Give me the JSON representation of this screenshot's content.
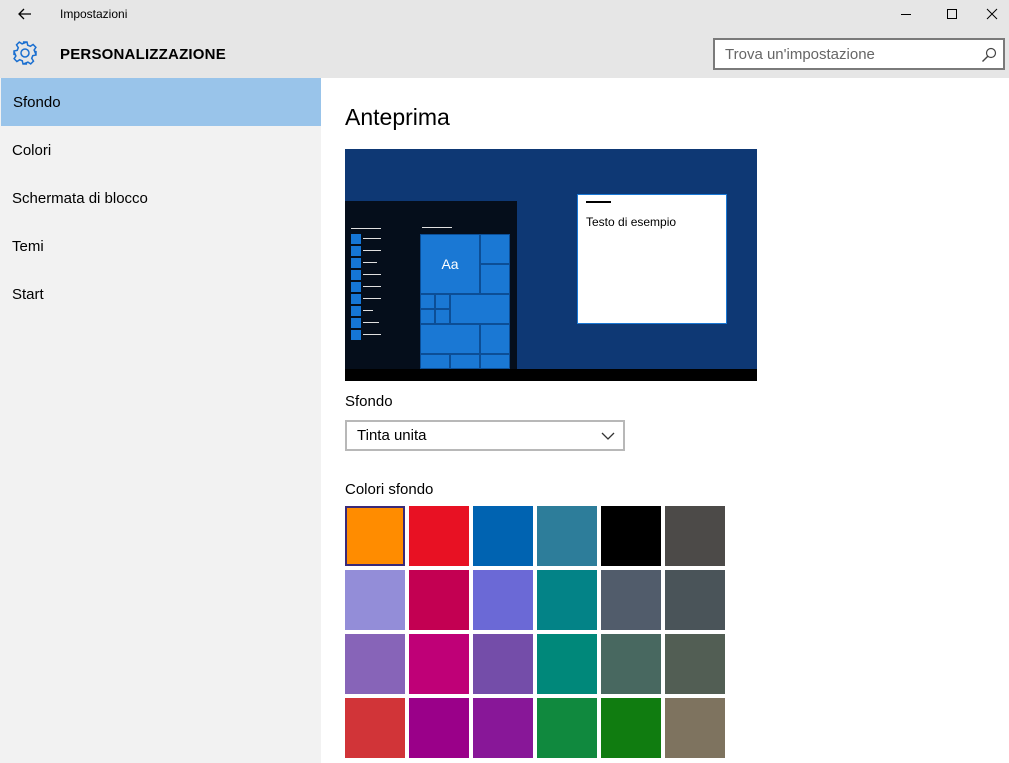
{
  "window": {
    "app_title": "Impostazioni",
    "icons": {
      "back": "back-arrow-icon",
      "minimize": "minimize-icon",
      "maximize": "maximize-icon",
      "close": "close-icon"
    }
  },
  "header": {
    "section_title": "PERSONALIZZAZIONE",
    "icon": "gear-icon",
    "search_placeholder": "Trova un'impostazione",
    "search_icon": "search-icon"
  },
  "sidebar": {
    "items": [
      {
        "label": "Sfondo",
        "selected": true
      },
      {
        "label": "Colori"
      },
      {
        "label": "Schermata di blocco"
      },
      {
        "label": "Temi"
      },
      {
        "label": "Start"
      }
    ]
  },
  "main": {
    "heading": "Anteprima",
    "preview": {
      "tile_label": "Aa",
      "window_text": "Testo di esempio",
      "desktop_color": "#0e3874"
    },
    "background_label": "Sfondo",
    "background_value": "Tinta unita",
    "colors_label": "Colori sfondo",
    "selected_color_index": 0,
    "colors": [
      "#ff8c00",
      "#e81123",
      "#0063b1",
      "#2d7d9a",
      "#000000",
      "#4c4a48",
      "#938dd8",
      "#c30052",
      "#6b69d6",
      "#038387",
      "#515c6b",
      "#4a5459",
      "#8764b8",
      "#bf0077",
      "#744da9",
      "#00887a",
      "#486860",
      "#525e54",
      "#d13438",
      "#9a0089",
      "#881798",
      "#10893e",
      "#107c10",
      "#7e735f"
    ]
  },
  "accent": {
    "selection": "#99c4ea"
  }
}
